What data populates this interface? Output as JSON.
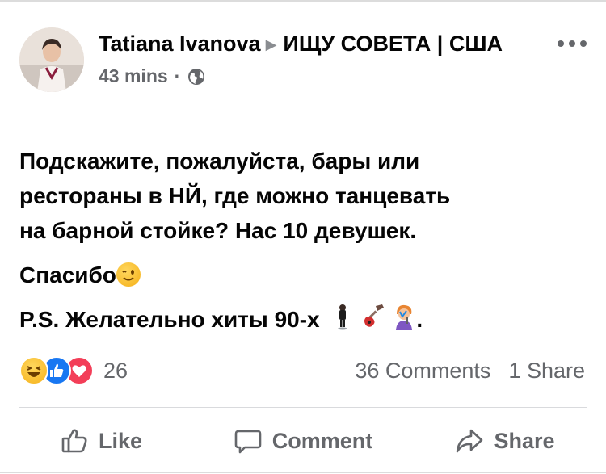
{
  "post": {
    "author": "Tatiana Ivanova",
    "group": "ИЩУ СОВЕТА | США",
    "time": "43 mins",
    "separator": "·",
    "body": {
      "line1": "Подскажите, пожалуйста, бары или",
      "line2": "рестораны в НЙ, где можно танцевать",
      "line3": "на барной стойке? Нас 10 девушек.",
      "thanks": "Спасибо",
      "ps": "P.S. Желательно хиты 90-х",
      "ps_end": "."
    },
    "reactions": {
      "count": "26",
      "types": [
        "haha-icon",
        "like-icon",
        "love-icon"
      ]
    },
    "comments": "36 Comments",
    "shares": "1 Share"
  },
  "actions": {
    "like": "Like",
    "comment": "Comment",
    "share": "Share"
  },
  "colors": {
    "meta": "#65676b",
    "like_blue": "#1877f2",
    "love_red": "#f33e58",
    "haha_yellow": "#f7b928"
  }
}
